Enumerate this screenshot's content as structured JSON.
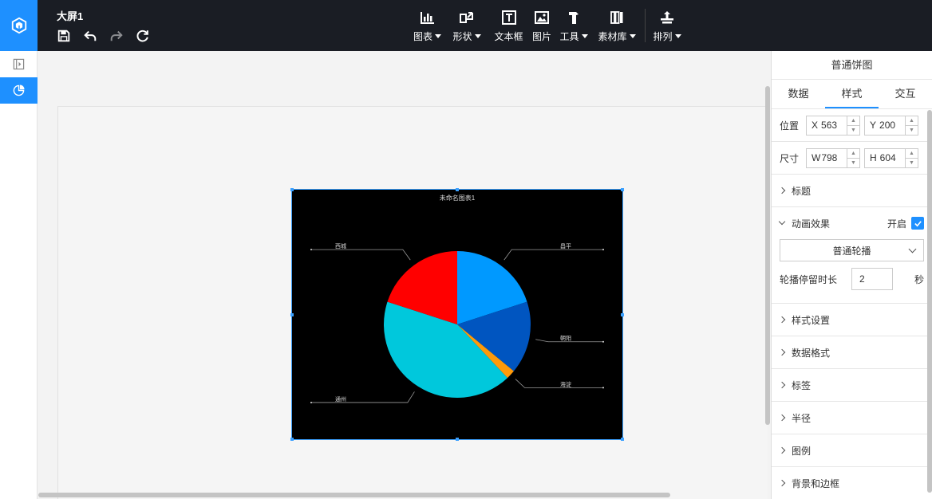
{
  "app": {
    "title": "大屏1"
  },
  "toolbar": {
    "items": [
      {
        "label": "图表",
        "icon": "bar-chart-icon",
        "dropdown": true
      },
      {
        "label": "形状",
        "icon": "shape-icon",
        "dropdown": true
      },
      {
        "label": "文本框",
        "icon": "textbox-icon",
        "dropdown": false
      },
      {
        "label": "图片",
        "icon": "image-icon",
        "dropdown": false
      },
      {
        "label": "工具",
        "icon": "tool-icon",
        "dropdown": true
      },
      {
        "label": "素材库",
        "icon": "material-library-icon",
        "dropdown": true
      },
      {
        "label": "排列",
        "icon": "arrange-icon",
        "dropdown": true
      }
    ]
  },
  "panel": {
    "title": "普通饼图",
    "tabs": [
      "数据",
      "样式",
      "交互"
    ],
    "active_tab": "样式",
    "position": {
      "label": "位置",
      "x_axis": "X",
      "x": "563",
      "y_axis": "Y",
      "y": "200"
    },
    "size": {
      "label": "尺寸",
      "w_axis": "W",
      "w": "798",
      "h_axis": "H",
      "h": "604"
    },
    "sections": {
      "title": "标题",
      "animation": "动画效果",
      "animation_enabled_label": "开启",
      "animation_enabled": true,
      "animation_mode": "普通轮播",
      "dwell_label": "轮播停留时长",
      "dwell_value": "2",
      "dwell_unit": "秒",
      "style": "样式设置",
      "data_format": "数据格式",
      "labels": "标签",
      "radius": "半径",
      "legend": "图例",
      "background": "背景和边框"
    }
  },
  "colors": {
    "accent": "#1e90ff",
    "topbar": "#1a1d24"
  },
  "chart_data": {
    "type": "pie",
    "title": "未命名图表1",
    "slices": [
      {
        "name": "昌平",
        "value": 20,
        "color": "#0099ff"
      },
      {
        "name": "朝阳",
        "value": 16,
        "color": "#0055c0"
      },
      {
        "name": "海淀",
        "value": 2,
        "color": "#ff9a0a"
      },
      {
        "name": "通州",
        "value": 42,
        "color": "#00c8dc"
      },
      {
        "name": "西城",
        "value": 20,
        "color": "#ff0000"
      }
    ]
  }
}
